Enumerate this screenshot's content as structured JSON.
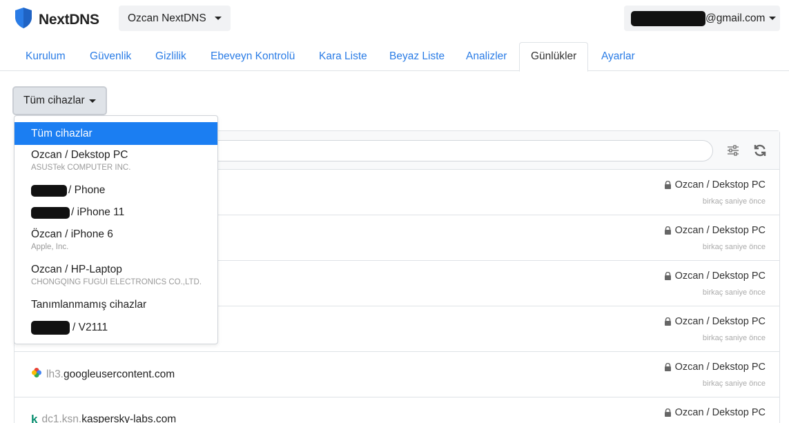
{
  "header": {
    "brand": "NextDNS",
    "profile": "Ozcan NextDNS",
    "account_suffix": "@gmail.com"
  },
  "tabs": [
    {
      "label": "Kurulum"
    },
    {
      "label": "Güvenlik"
    },
    {
      "label": "Gizlilik"
    },
    {
      "label": "Ebeveyn Kontrolü"
    },
    {
      "label": "Kara Liste"
    },
    {
      "label": "Beyaz Liste"
    },
    {
      "label": "Analizler"
    },
    {
      "label": "Günlükler"
    },
    {
      "label": "Ayarlar"
    }
  ],
  "active_tab": "Günlükler",
  "device_filter": {
    "selected": "Tüm cihazlar",
    "options": [
      {
        "label": "Tüm cihazlar",
        "vendor": ""
      },
      {
        "label": "Ozcan / Dekstop PC",
        "vendor": "ASUSTek COMPUTER INC."
      },
      {
        "label": "/ Phone",
        "vendor": ""
      },
      {
        "label": "/ iPhone 11",
        "vendor": ""
      },
      {
        "label": "Özcan / iPhone 6",
        "vendor": "Apple, Inc."
      },
      {
        "label": "Ozcan / HP-Laptop",
        "vendor": "CHONGQING FUGUI ELECTRONICS CO.,LTD."
      },
      {
        "label": "Tanımlanmamış cihazlar",
        "vendor": ""
      },
      {
        "label": "/ V2111",
        "vendor": ""
      }
    ]
  },
  "logs": [
    {
      "sub": "",
      "domain": "",
      "device": "Ozcan / Dekstop PC",
      "time": "birkaç saniye önce"
    },
    {
      "sub": "",
      "domain": "",
      "device": "Ozcan / Dekstop PC",
      "time": "birkaç saniye önce"
    },
    {
      "sub": "",
      "domain": "",
      "device": "Ozcan / Dekstop PC",
      "time": "birkaç saniye önce"
    },
    {
      "sub": "",
      "domain": "",
      "device": "Ozcan / Dekstop PC",
      "time": "birkaç saniye önce"
    },
    {
      "sub": "lh3.",
      "domain": "googleusercontent.com",
      "device": "Ozcan / Dekstop PC",
      "time": "birkaç saniye önce"
    },
    {
      "sub": "dc1.ksn.",
      "domain": "kaspersky-labs.com",
      "device": "Ozcan / Dekstop PC",
      "time": ""
    }
  ],
  "colors": {
    "link": "#2a7ce6",
    "active_item": "#1b7ef2",
    "brand_shield": "#2a7ce6"
  },
  "icons": [
    "shield-logo-icon",
    "caret-down-icon",
    "filter-sliders-icon",
    "refresh-icon",
    "lock-icon",
    "google-photos-icon",
    "kaspersky-icon"
  ]
}
